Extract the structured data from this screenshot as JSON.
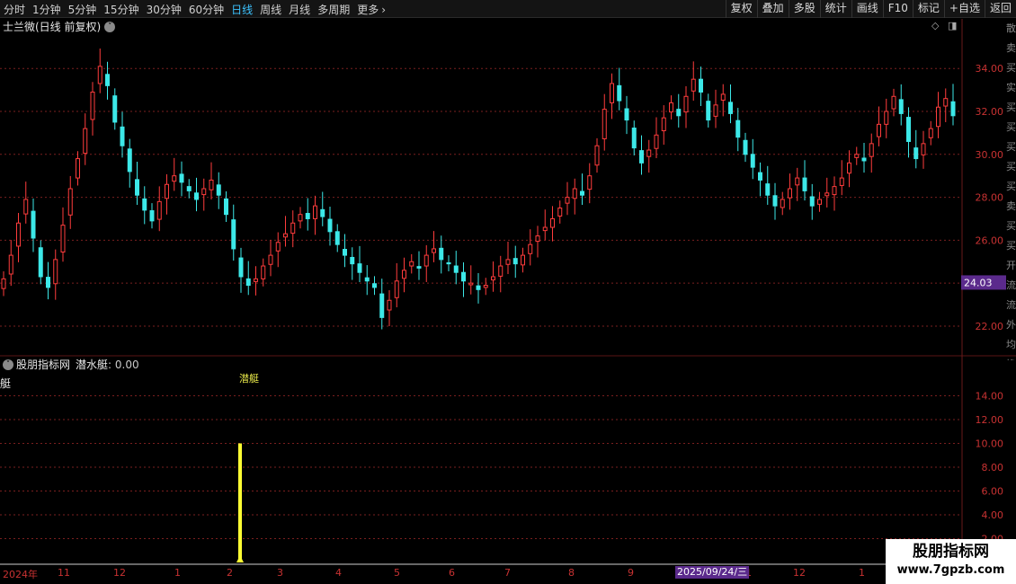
{
  "toolbar": {
    "periods": [
      "分时",
      "1分钟",
      "5分钟",
      "15分钟",
      "30分钟",
      "60分钟",
      "日线",
      "周线",
      "月线",
      "多周期",
      "更多"
    ],
    "active_period": "日线",
    "right_tools": [
      "复权",
      "叠加",
      "多股",
      "统计",
      "画线",
      "F10",
      "标记",
      "+自选",
      "返回"
    ]
  },
  "main_chart": {
    "title": "士兰微(日线 前复权)",
    "price_label": "24.03",
    "right_strip_text": "散卖买实买买买买买卖买买开流流外均换收"
  },
  "sub_chart": {
    "indicator": "股朋指标网",
    "series_name": "潜水艇",
    "value_text": "0.00",
    "left_label": "艇",
    "signal_text": "潜艇",
    "y_ticks": [
      "14.00",
      "12.00",
      "10.00",
      "8.00",
      "6.00",
      "4.00",
      "2.00"
    ]
  },
  "date_axis": {
    "labels": [
      "2024年",
      "11",
      "12",
      "1",
      "2",
      "3",
      "4",
      "5",
      "6",
      "7",
      "8",
      "9",
      "1",
      "12",
      "1"
    ],
    "cursor_date": "2025/09/24/三"
  },
  "watermark": {
    "title": "股朋指标网",
    "url": "www.7gpzb.com"
  },
  "colors": {
    "up": "#ff3c3c",
    "down": "#3ce8e8",
    "grid": "#7a1f1f",
    "axis_text": "#c83232",
    "signal": "#ffff33",
    "active_tab": "#3cc3ff"
  },
  "chart_data": [
    {
      "type": "candlestick",
      "title": "士兰微(日线 前复权)",
      "y_ticks": [
        22,
        24,
        26,
        28,
        30,
        32,
        34
      ],
      "ylim": [
        20.7,
        35.6
      ],
      "last_price": 24.03,
      "closes": [
        24.2,
        25.3,
        26.8,
        27.9,
        26.1,
        24.3,
        23.8,
        25.1,
        26.7,
        28.4,
        29.8,
        31.2,
        32.9,
        34.1,
        33.2,
        31.5,
        30.4,
        29.2,
        28.1,
        27.4,
        26.9,
        27.8,
        28.6,
        29.0,
        28.7,
        28.3,
        27.9,
        28.4,
        28.8,
        28.1,
        27.2,
        25.6,
        24.3,
        23.9,
        24.2,
        24.8,
        25.3,
        25.9,
        26.3,
        26.8,
        27.2,
        27.0,
        27.6,
        27.1,
        26.4,
        25.8,
        25.3,
        24.9,
        24.5,
        24.1,
        23.8,
        22.4,
        23.2,
        24.1,
        24.6,
        25.0,
        24.7,
        25.3,
        25.6,
        25.1,
        24.9,
        24.5,
        24.1,
        24.0,
        23.7,
        23.9,
        24.3,
        24.8,
        25.1,
        24.9,
        25.3,
        25.8,
        26.2,
        26.6,
        27.0,
        27.5,
        28.0,
        28.4,
        28.1,
        29.0,
        30.4,
        32.1,
        33.3,
        32.5,
        31.6,
        30.3,
        29.6,
        30.2,
        30.9,
        31.7,
        32.4,
        31.8,
        32.7,
        33.5,
        32.9,
        31.6,
        32.3,
        32.8,
        31.9,
        30.8,
        30.0,
        29.4,
        28.8,
        28.1,
        27.6,
        27.9,
        28.4,
        28.9,
        28.3,
        27.6,
        27.9,
        28.2,
        28.5,
        28.9,
        29.6,
        30.0,
        29.7,
        30.5,
        31.4,
        32.0,
        32.7,
        31.9,
        30.6,
        29.8,
        30.5,
        31.2,
        32.2,
        32.6,
        31.8
      ],
      "subplot": {
        "series_name": "潜水艇",
        "y_ticks": [
          2,
          4,
          6,
          8,
          10,
          12,
          14
        ],
        "ylim": [
          0,
          16
        ],
        "signal_bar_value": 10,
        "signal_bar_index": 32,
        "current_value": 0.0
      }
    }
  ]
}
